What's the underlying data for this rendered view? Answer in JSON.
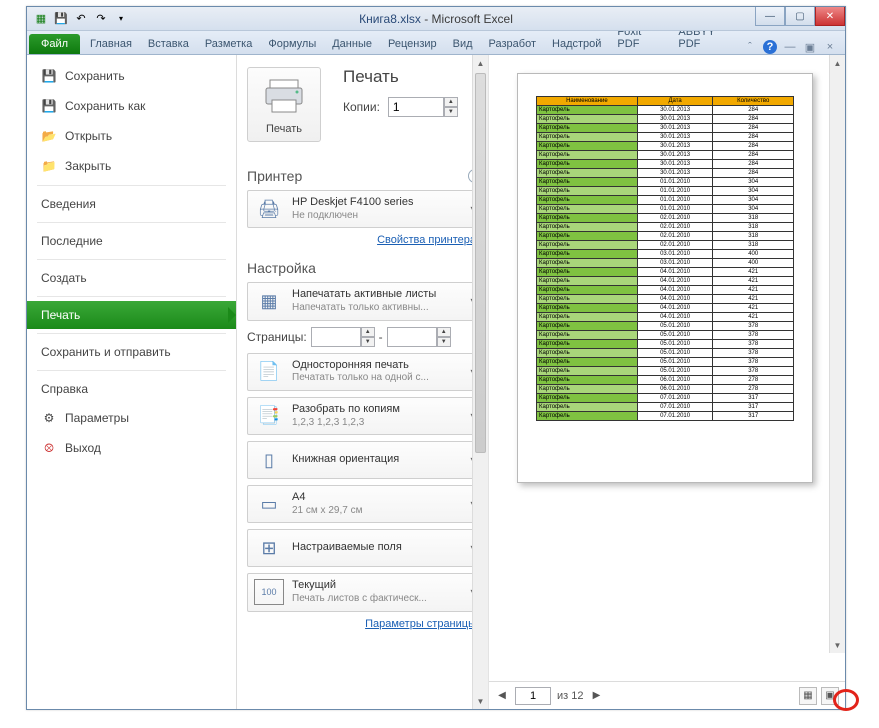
{
  "title": {
    "filename": "Книга8.xlsx",
    "app": "Microsoft Excel"
  },
  "ribbon": {
    "file": "Файл",
    "tabs": [
      "Главная",
      "Вставка",
      "Разметка",
      "Формулы",
      "Данные",
      "Рецензир",
      "Вид",
      "Разработ",
      "Надстрой",
      "Foxit PDF",
      "ABBYY PDF"
    ]
  },
  "sidebar": {
    "items": [
      {
        "label": "Сохранить",
        "icon": "💾"
      },
      {
        "label": "Сохранить как",
        "icon": "💾"
      },
      {
        "label": "Открыть",
        "icon": "📂"
      },
      {
        "label": "Закрыть",
        "icon": "📁"
      },
      {
        "label": "Сведения"
      },
      {
        "label": "Последние"
      },
      {
        "label": "Создать"
      },
      {
        "label": "Печать",
        "selected": true
      },
      {
        "label": "Сохранить и отправить"
      },
      {
        "label": "Справка"
      },
      {
        "label": "Параметры",
        "icon": "⚙"
      },
      {
        "label": "Выход",
        "icon": "�×"
      }
    ]
  },
  "print": {
    "heading": "Печать",
    "button_label": "Печать",
    "copies_label": "Копии:",
    "copies_value": "1",
    "printer_section": "Принтер",
    "printer_name": "HP Deskjet F4100 series",
    "printer_status": "Не подключен",
    "printer_link": "Свойства принтера",
    "settings_section": "Настройка",
    "settings": [
      {
        "title": "Напечатать активные листы",
        "sub": "Напечатать только активны...",
        "icon": "▦"
      },
      {
        "title": "Односторонняя печать",
        "sub": "Печатать только на одной с...",
        "icon": "📄"
      },
      {
        "title": "Разобрать по копиям",
        "sub": "1,2,3   1,2,3   1,2,3",
        "icon": "📑"
      },
      {
        "title": "Книжная ориентация",
        "sub": "",
        "icon": "▯"
      },
      {
        "title": "A4",
        "sub": "21 см x 29,7 см",
        "icon": "▭"
      },
      {
        "title": "Настраиваемые поля",
        "sub": "",
        "icon": "⊞"
      },
      {
        "title": "Текущий",
        "sub": "Печать листов с фактическ...",
        "icon": "100"
      }
    ],
    "pages_label": "Страницы:",
    "pages_sep": "-",
    "page_setup_link": "Параметры страницы"
  },
  "preview": {
    "page_current": "1",
    "page_of": "из 12",
    "table_headers": [
      "Наименование",
      "Дата",
      "Количество"
    ],
    "rows": [
      [
        "Картофель",
        "30.01.2013",
        "284"
      ],
      [
        "Картофель",
        "30.01.2013",
        "284"
      ],
      [
        "Картофель",
        "30.01.2013",
        "284"
      ],
      [
        "Картофель",
        "30.01.2013",
        "284"
      ],
      [
        "Картофель",
        "30.01.2013",
        "284"
      ],
      [
        "Картофель",
        "30.01.2013",
        "284"
      ],
      [
        "Картофель",
        "30.01.2013",
        "284"
      ],
      [
        "Картофель",
        "30.01.2013",
        "284"
      ],
      [
        "Картофель",
        "01.01.2010",
        "304"
      ],
      [
        "Картофель",
        "01.01.2010",
        "304"
      ],
      [
        "Картофель",
        "01.01.2010",
        "304"
      ],
      [
        "Картофель",
        "01.01.2010",
        "304"
      ],
      [
        "Картофель",
        "02.01.2010",
        "318"
      ],
      [
        "Картофель",
        "02.01.2010",
        "318"
      ],
      [
        "Картофель",
        "02.01.2010",
        "318"
      ],
      [
        "Картофель",
        "02.01.2010",
        "318"
      ],
      [
        "Картофель",
        "03.01.2010",
        "400"
      ],
      [
        "Картофель",
        "03.01.2010",
        "400"
      ],
      [
        "Картофель",
        "04.01.2010",
        "421"
      ],
      [
        "Картофель",
        "04.01.2010",
        "421"
      ],
      [
        "Картофель",
        "04.01.2010",
        "421"
      ],
      [
        "Картофель",
        "04.01.2010",
        "421"
      ],
      [
        "Картофель",
        "04.01.2010",
        "421"
      ],
      [
        "Картофель",
        "04.01.2010",
        "421"
      ],
      [
        "Картофель",
        "05.01.2010",
        "378"
      ],
      [
        "Картофель",
        "05.01.2010",
        "378"
      ],
      [
        "Картофель",
        "05.01.2010",
        "378"
      ],
      [
        "Картофель",
        "05.01.2010",
        "378"
      ],
      [
        "Картофель",
        "05.01.2010",
        "378"
      ],
      [
        "Картофель",
        "05.01.2010",
        "378"
      ],
      [
        "Картофель",
        "06.01.2010",
        "278"
      ],
      [
        "Картофель",
        "06.01.2010",
        "278"
      ],
      [
        "Картофель",
        "07.01.2010",
        "317"
      ],
      [
        "Картофель",
        "07.01.2010",
        "317"
      ],
      [
        "Картофель",
        "07.01.2010",
        "317"
      ]
    ]
  }
}
